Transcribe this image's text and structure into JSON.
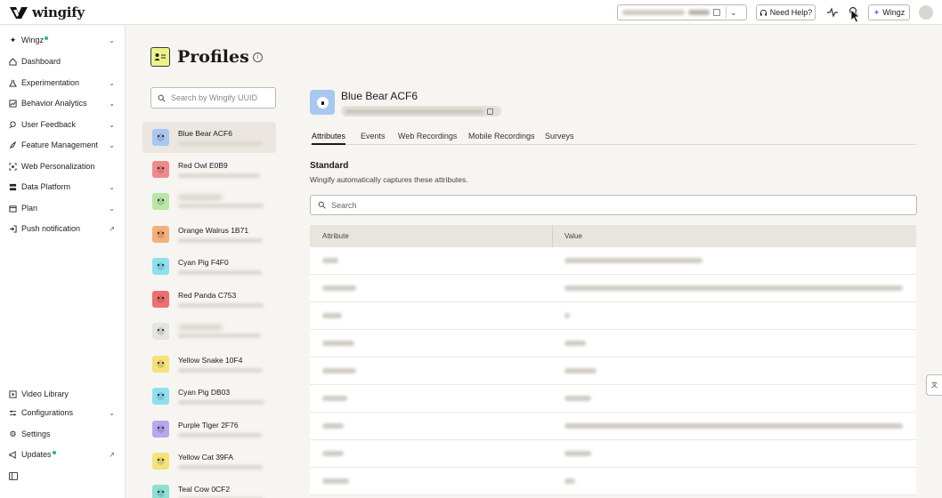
{
  "app": {
    "logo_text": "wingify"
  },
  "topbar": {
    "help_label": "Need Help?",
    "wingz_label": "Wingz"
  },
  "sidebar": {
    "items": [
      {
        "label": "Wingz",
        "icon": "sparkle-icon",
        "chevron": true,
        "dot": true
      },
      {
        "label": "Dashboard",
        "icon": "home-icon",
        "chevron": false
      },
      {
        "label": "Experimentation",
        "icon": "flask-icon",
        "chevron": true
      },
      {
        "label": "Behavior Analytics",
        "icon": "analytics-icon",
        "chevron": true
      },
      {
        "label": "User Feedback",
        "icon": "feedback-icon",
        "chevron": true
      },
      {
        "label": "Feature Management",
        "icon": "rocket-icon",
        "chevron": true
      },
      {
        "label": "Web Personalization",
        "icon": "personalize-icon",
        "chevron": false
      },
      {
        "label": "Data Platform",
        "icon": "database-icon",
        "chevron": true
      },
      {
        "label": "Plan",
        "icon": "calendar-icon",
        "chevron": true
      },
      {
        "label": "Push notification",
        "icon": "push-icon",
        "external": true
      }
    ],
    "bottom_items": [
      {
        "label": "Video Library",
        "icon": "video-icon"
      },
      {
        "label": "Configurations",
        "icon": "sliders-icon",
        "chevron": true
      },
      {
        "label": "Settings",
        "icon": "gear-icon"
      },
      {
        "label": "Updates",
        "icon": "megaphone-icon",
        "dot": true,
        "external": true
      }
    ]
  },
  "page": {
    "title": "Profiles",
    "search_placeholder": "Search by Wingify UUID"
  },
  "profiles": [
    {
      "name": "Blue Bear ACF6",
      "color": "#a8c8f0",
      "selected": true
    },
    {
      "name": "Red Owl E0B9",
      "color": "#f08a8a"
    },
    {
      "name": "",
      "color": "#b9e6a8",
      "hidden": true
    },
    {
      "name": "Orange Walrus 1B71",
      "color": "#f5b07a"
    },
    {
      "name": "Cyan Pig F4F0",
      "color": "#8ee0ee"
    },
    {
      "name": "Red Panda C753",
      "color": "#ec7070"
    },
    {
      "name": "",
      "color": "#e4e4e4",
      "hidden": true
    },
    {
      "name": "Yellow Snake 10F4",
      "color": "#f5e27a"
    },
    {
      "name": "Cyan Pig DB03",
      "color": "#8ee0ee"
    },
    {
      "name": "Purple Tiger 2F76",
      "color": "#b9a6ec"
    },
    {
      "name": "Yellow Cat 39FA",
      "color": "#f5e27a"
    },
    {
      "name": "Teal Cow 0CF2",
      "color": "#8ee0d2"
    }
  ],
  "detail": {
    "name": "Blue Bear ACF6",
    "tabs": [
      "Attributes",
      "Events",
      "Web Recordings",
      "Mobile Recordings",
      "Surveys"
    ],
    "active_tab": "Attributes",
    "section_title": "Standard",
    "section_desc": "Wingify automatically captures these attributes.",
    "search_placeholder": "Search",
    "columns": [
      "Attribute",
      "Value"
    ]
  }
}
